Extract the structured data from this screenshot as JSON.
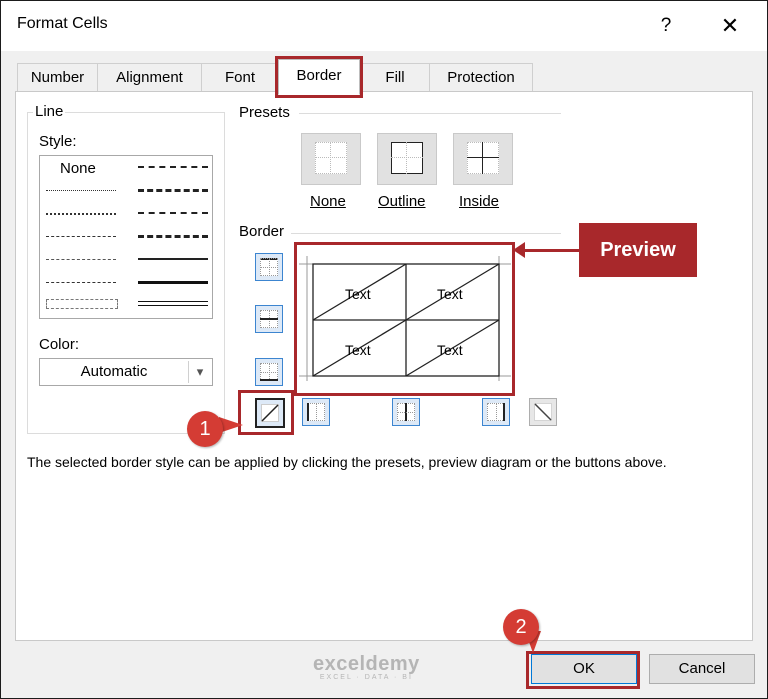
{
  "window": {
    "title": "Format Cells",
    "help_label": "?",
    "close_label": "✕"
  },
  "tabs": [
    {
      "label": "Number"
    },
    {
      "label": "Alignment"
    },
    {
      "label": "Font"
    },
    {
      "label": "Border"
    },
    {
      "label": "Fill"
    },
    {
      "label": "Protection"
    }
  ],
  "active_tab": "Border",
  "line_group": {
    "label": "Line",
    "style_label": "Style:",
    "style_none": "None",
    "color_label": "Color:",
    "color_value": "Automatic"
  },
  "presets": {
    "label": "Presets",
    "items": [
      {
        "label": "None",
        "icon": "preset-none-icon"
      },
      {
        "label": "Outline",
        "icon": "preset-outline-icon"
      },
      {
        "label": "Inside",
        "icon": "preset-inside-icon"
      }
    ]
  },
  "border_group": {
    "label": "Border",
    "preview_texts": [
      "Text",
      "Text",
      "Text",
      "Text"
    ],
    "buttons": [
      "border-top-icon",
      "border-inside-horizontal-icon",
      "border-bottom-icon",
      "border-diagonal-up-icon",
      "border-left-icon",
      "border-inside-vertical-icon",
      "border-right-icon",
      "border-diagonal-down-icon"
    ]
  },
  "description": "The selected border style can be applied by clicking the presets, preview diagram or the buttons above.",
  "buttons": {
    "ok": "OK",
    "cancel": "Cancel"
  },
  "annotations": {
    "preview_callout": "Preview",
    "step1": "1",
    "step2": "2"
  },
  "watermark": {
    "name": "exceldemy",
    "tagline": "EXCEL · DATA · BI"
  },
  "colors": {
    "accent_red": "#a8282b",
    "step_red": "#d43c34",
    "selection_blue": "#0078d7"
  }
}
